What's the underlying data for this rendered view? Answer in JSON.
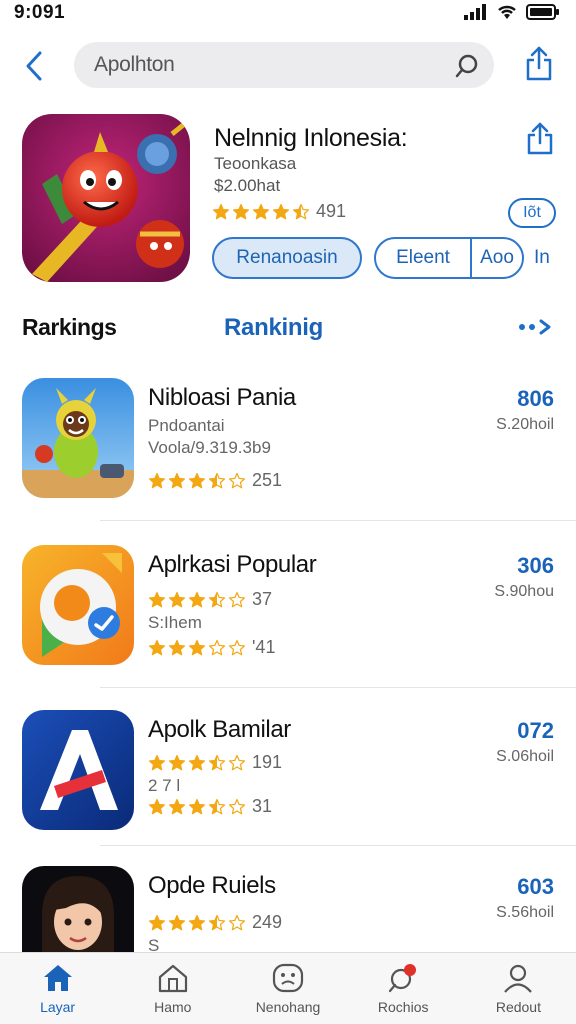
{
  "status": {
    "time": "9:091"
  },
  "search": {
    "query": "Apolhton"
  },
  "app": {
    "title": "Nelnnig Inlonesia:",
    "subtitle": "Teoonkasa",
    "price_line": "$2.00hat",
    "rating_count": "491",
    "rating_stars": 4.5,
    "get_label": "Iõt",
    "primary_button": "Renanoasin",
    "seg_left": "Eleent",
    "seg_right": "Aoo",
    "more_label": "In"
  },
  "section": {
    "left_title": "Rarkings",
    "center_title": "Rankinig"
  },
  "items": [
    {
      "title": "Nibloasi Pania",
      "line1": "Pndoantai",
      "line2": "Voola/9.319.3b9",
      "rating_stars": 3.5,
      "rating_count": "251",
      "price": "806",
      "sub_price": "S.20hoil"
    },
    {
      "title": "Aplrkasi Popular",
      "rating_stars": 3.5,
      "rating_count": "37",
      "line1": "S:Ihem",
      "rating2_stars": 3,
      "rating2_count": "'41",
      "price": "306",
      "sub_price": "S.90hou"
    },
    {
      "title": "Apolk Bamilar",
      "rating_stars": 3.5,
      "rating_count": "191",
      "line1": "2 7 l",
      "rating2_stars": 3.5,
      "rating2_count": "31",
      "price": "072",
      "sub_price": "S.06hoil"
    },
    {
      "title": "Opde Ruiels",
      "rating_stars": 3.5,
      "rating_count": "249",
      "line1": "S",
      "price": "603",
      "sub_price": "S.56hoil"
    }
  ],
  "tabs": [
    {
      "label": "Layar",
      "icon": "home-icon",
      "active": true
    },
    {
      "label": "Hamo",
      "icon": "house-outline-icon",
      "active": false
    },
    {
      "label": "Nenohang",
      "icon": "face-icon",
      "active": false
    },
    {
      "label": "Rochios",
      "icon": "search-badge-icon",
      "active": false
    },
    {
      "label": "Redout",
      "icon": "person-icon",
      "active": false
    }
  ],
  "colors": {
    "accent": "#1a63b8",
    "star": "#f3a712",
    "tab_active": "#1a63b8"
  }
}
